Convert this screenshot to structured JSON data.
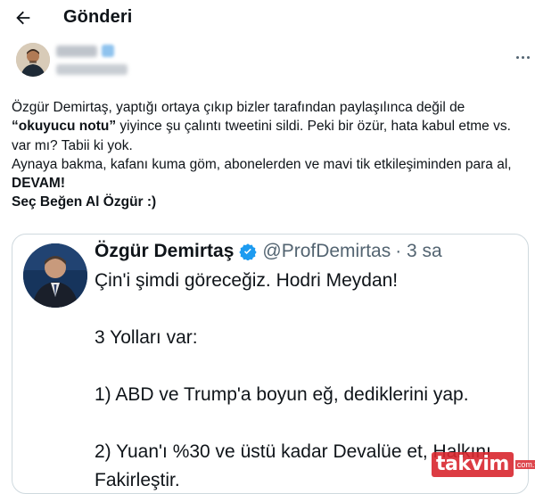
{
  "header": {
    "title": "Gönderi"
  },
  "tweet": {
    "lines": [
      {
        "pre": "Özgür Demirtaş, yaptığı ortaya çıkıp bizler tarafından paylaşılınca değil de ",
        "bold": "“okuyucu notu”",
        "post": " yiyince şu çalıntı tweetini sildi. Peki bir özür, hata kabul etme vs. var mı? Tabii ki yok."
      },
      {
        "pre": "Aynaya bakma, kafanı kuma göm, abonelerden ve mavi tik etkileşiminden para al, ",
        "bold": "DEVAM!",
        "post": ""
      },
      {
        "pre": "",
        "bold": "Seç Beğen Al Özgür :)",
        "post": ""
      }
    ]
  },
  "quote": {
    "name": "Özgür Demirtaş",
    "handle": "@ProfDemirtas",
    "time": "· 3 sa",
    "paragraphs": [
      "Çin'i şimdi göreceğiz. Hodri Meydan!",
      "3 Yolları var:",
      "1) ABD ve Trump'a boyun eğ, dediklerini yap.",
      "2) Yuan'ı %30 ve üstü kadar Devalüe et, Halkını Fakirleştir."
    ]
  },
  "watermark": {
    "brand": "takvim",
    "suffix": "com.tr"
  },
  "colors": {
    "text": "#0f1419",
    "secondary": "#536471",
    "border": "#cfd9de",
    "verified": "#1d9bf0",
    "watermark": "#d9282f"
  }
}
